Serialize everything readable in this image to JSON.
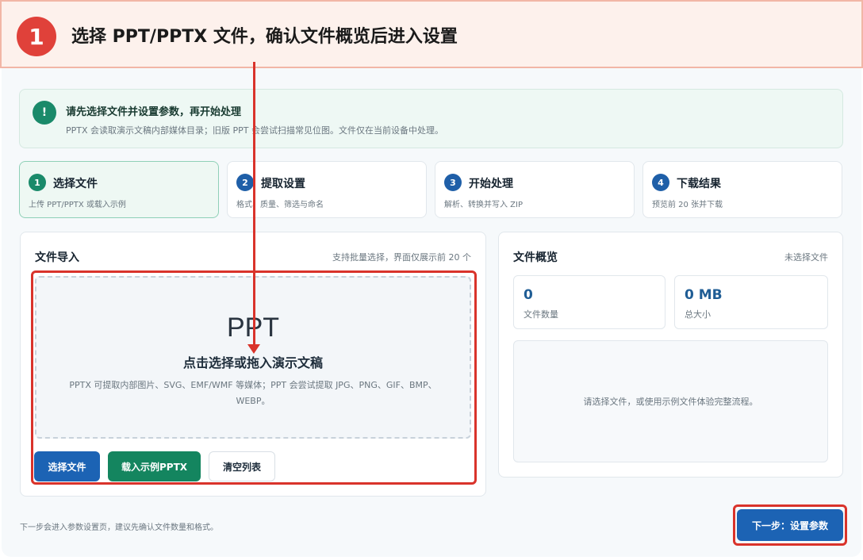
{
  "banner": {
    "step_number": "1",
    "title": "选择 PPT/PPTX 文件，确认文件概览后进入设置"
  },
  "notice": {
    "icon": "!",
    "title": "请先选择文件并设置参数，再开始处理",
    "desc": "PPTX 会读取演示文稿内部媒体目录；旧版 PPT 会尝试扫描常见位图。文件仅在当前设备中处理。"
  },
  "steps": [
    {
      "num": "1",
      "title": "选择文件",
      "desc": "上传 PPT/PPTX 或载入示例"
    },
    {
      "num": "2",
      "title": "提取设置",
      "desc": "格式、质量、筛选与命名"
    },
    {
      "num": "3",
      "title": "开始处理",
      "desc": "解析、转换并写入 ZIP"
    },
    {
      "num": "4",
      "title": "下载结果",
      "desc": "预览前 20 张并下载"
    }
  ],
  "import_panel": {
    "title": "文件导入",
    "hint": "支持批量选择，界面仅展示前 20 个",
    "dropzone": {
      "big_label": "PPT",
      "title": "点击选择或拖入演示文稿",
      "desc": "PPTX 可提取内部图片、SVG、EMF/WMF 等媒体；PPT 会尝试提取 JPG、PNG、GIF、BMP、WEBP。"
    },
    "buttons": {
      "select": "选择文件",
      "load_sample": "载入示例PPTX",
      "clear": "清空列表"
    }
  },
  "overview_panel": {
    "title": "文件概览",
    "status": "未选择文件",
    "stats": [
      {
        "value": "0",
        "label": "文件数量"
      },
      {
        "value": "0 MB",
        "label": "总大小"
      }
    ],
    "empty_text": "请选择文件，或使用示例文件体验完整流程。"
  },
  "footer": {
    "hint": "下一步会进入参数设置页，建议先确认文件数量和格式。",
    "next_label": "下一步：设置参数"
  },
  "colors": {
    "accent_red": "#d9332b",
    "primary_blue": "#1c63b4",
    "primary_green": "#14855f"
  }
}
